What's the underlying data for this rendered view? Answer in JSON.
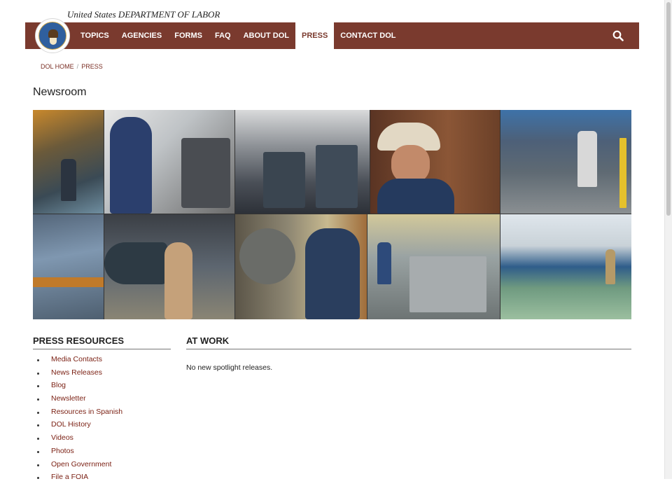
{
  "header": {
    "agency_line": "United States DEPARTMENT OF LABOR",
    "nav_items": [
      {
        "label": "TOPICS"
      },
      {
        "label": "AGENCIES"
      },
      {
        "label": "FORMS"
      },
      {
        "label": "FAQ"
      },
      {
        "label": "ABOUT DOL"
      },
      {
        "label": "PRESS",
        "active": true
      },
      {
        "label": "CONTACT DOL"
      }
    ],
    "nav_color": "#7a3a2e",
    "search_icon": "search-icon"
  },
  "breadcrumb": {
    "items": [
      "DOL HOME",
      "PRESS"
    ],
    "separator": "/"
  },
  "page": {
    "title": "Newsroom"
  },
  "sidebar": {
    "heading": "PRESS RESOURCES",
    "items": [
      {
        "label": "Media Contacts"
      },
      {
        "label": "News Releases"
      },
      {
        "label": "Blog"
      },
      {
        "label": "Newsletter"
      },
      {
        "label": "Resources in Spanish"
      },
      {
        "label": "DOL History"
      },
      {
        "label": "Videos"
      },
      {
        "label": "Photos"
      },
      {
        "label": "Open Government"
      },
      {
        "label": "File a FOIA"
      }
    ]
  },
  "main": {
    "heading": "AT WORK",
    "empty_message": "No new spotlight releases."
  },
  "colors": {
    "accent": "#7a3a2e",
    "link": "#7a1f12"
  }
}
